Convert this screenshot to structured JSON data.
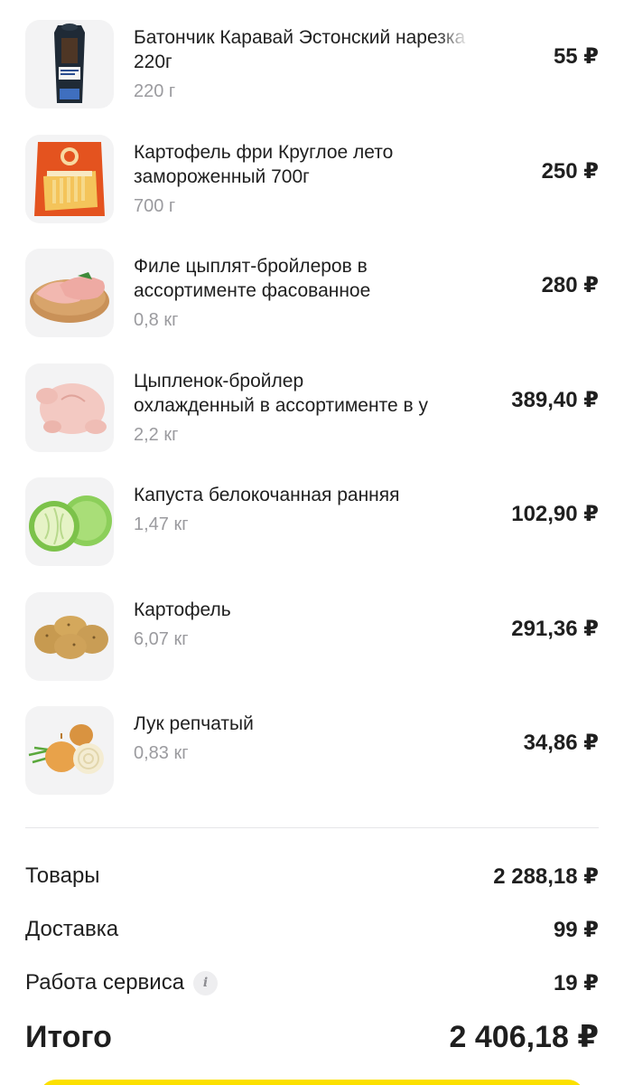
{
  "items": [
    {
      "title_line1": "Батончик Каравай Эстонский нарезка",
      "title_line2": "220г",
      "weight": "220 г",
      "price": "55 ₽",
      "image": "bread-package-icon"
    },
    {
      "title_line1": "Картофель фри Круглое лето",
      "title_line2": "замороженный 700г",
      "weight": "700 г",
      "price": "250 ₽",
      "image": "fries-package-icon"
    },
    {
      "title_line1": "Филе цыплят-бройлеров в",
      "title_line2": "ассортименте фасованное",
      "weight": "0,8 кг",
      "price": "280 ₽",
      "image": "chicken-fillet-icon"
    },
    {
      "title_line1": "Цыпленок-бройлер",
      "title_line2": "охлажденный в ассортименте в у",
      "weight": "2,2 кг",
      "price": "389,40 ₽",
      "image": "whole-chicken-icon"
    },
    {
      "title_line1": "Капуста белокочанная ранняя",
      "title_line2": "",
      "weight": "1,47 кг",
      "price": "102,90 ₽",
      "image": "cabbage-icon"
    },
    {
      "title_line1": "Картофель",
      "title_line2": "",
      "weight": "6,07 кг",
      "price": "291,36 ₽",
      "image": "potatoes-icon"
    },
    {
      "title_line1": "Лук репчатый",
      "title_line2": "",
      "weight": "0,83 кг",
      "price": "34,86 ₽",
      "image": "onion-icon"
    }
  ],
  "summary": {
    "goods_label": "Товары",
    "goods_value": "2 288,18 ₽",
    "delivery_label": "Доставка",
    "delivery_value": "99 ₽",
    "service_label": "Работа сервиса",
    "service_info_glyph": "i",
    "service_value": "19 ₽",
    "total_label": "Итого",
    "total_value": "2 406,18 ₽"
  },
  "colors": {
    "accent_yellow": "#fce000",
    "text_primary": "#1f1f1f",
    "text_secondary": "#9b9b9f",
    "thumb_bg": "#f3f3f4"
  }
}
